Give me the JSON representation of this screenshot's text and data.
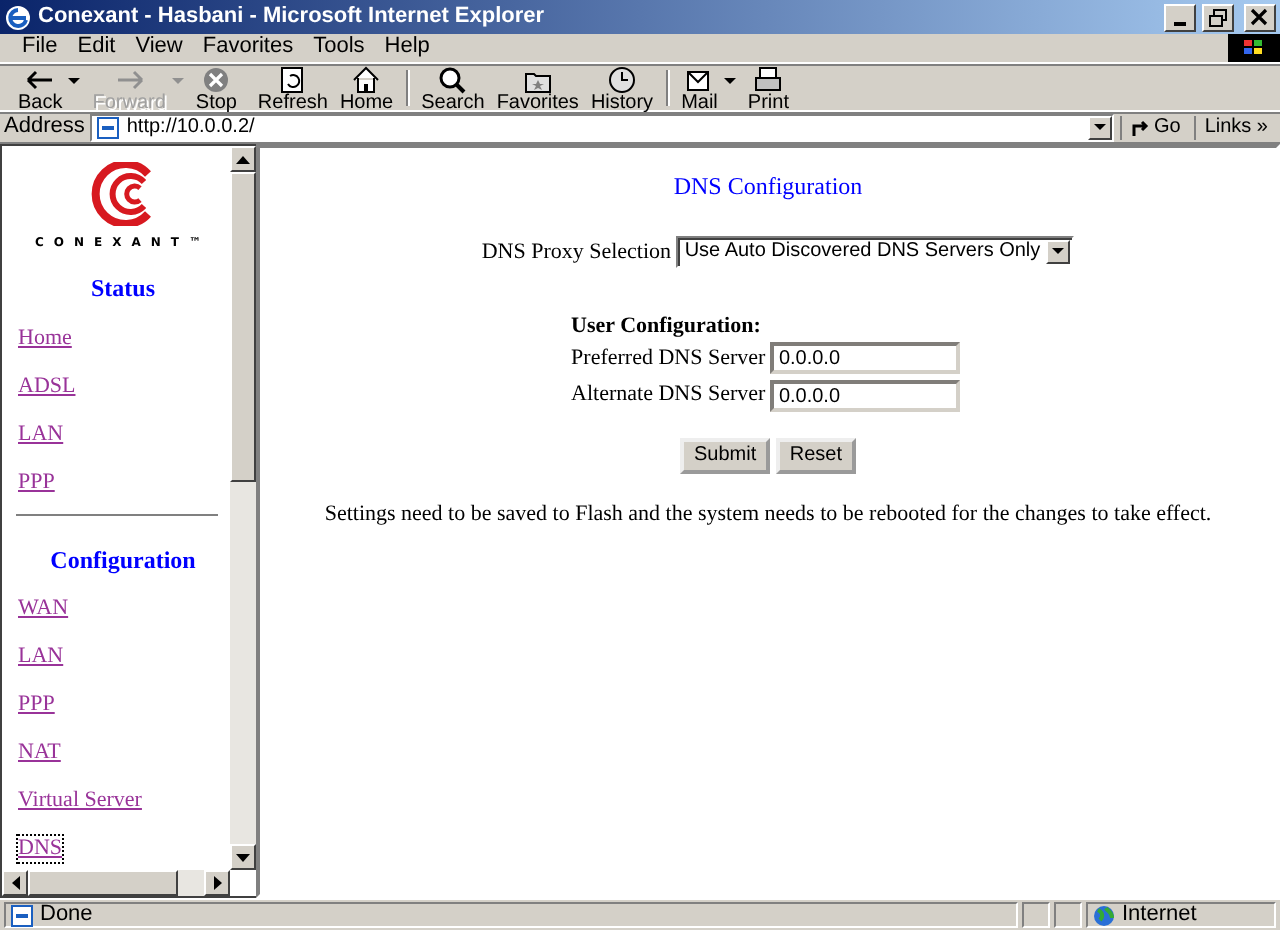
{
  "window": {
    "title": "Conexant - Hasbani - Microsoft Internet Explorer"
  },
  "menu": [
    "File",
    "Edit",
    "View",
    "Favorites",
    "Tools",
    "Help"
  ],
  "toolbar": [
    [
      {
        "label": "Back",
        "disabled": false,
        "dropdown": true
      },
      {
        "label": "Forward",
        "disabled": true,
        "dropdown": true
      },
      {
        "label": "Stop",
        "disabled": false,
        "dropdown": false
      },
      {
        "label": "Refresh",
        "disabled": false,
        "dropdown": false
      },
      {
        "label": "Home",
        "disabled": false,
        "dropdown": false
      }
    ],
    [
      {
        "label": "Search",
        "disabled": false,
        "dropdown": false
      },
      {
        "label": "Favorites",
        "disabled": false,
        "dropdown": false
      },
      {
        "label": "History",
        "disabled": false,
        "dropdown": false
      }
    ],
    [
      {
        "label": "Mail",
        "disabled": false,
        "dropdown": true
      },
      {
        "label": "Print",
        "disabled": false,
        "dropdown": false
      }
    ]
  ],
  "address_bar": {
    "label": "Address",
    "url": "http://10.0.0.2/",
    "go": "Go",
    "links": "Links",
    "links_chevron": "»"
  },
  "sidebar": {
    "logo_text": "CONEXANT™",
    "sections": [
      {
        "heading": "Status",
        "links": [
          {
            "label": "Home",
            "selected": false
          },
          {
            "label": "ADSL",
            "selected": false
          },
          {
            "label": "LAN",
            "selected": false
          },
          {
            "label": "PPP",
            "selected": false
          }
        ]
      },
      {
        "heading": "Configuration",
        "links": [
          {
            "label": "WAN",
            "selected": false
          },
          {
            "label": "LAN",
            "selected": false
          },
          {
            "label": "PPP",
            "selected": false
          },
          {
            "label": "NAT",
            "selected": false
          },
          {
            "label": "Virtual Server",
            "selected": false
          },
          {
            "label": "DNS",
            "selected": true
          }
        ]
      }
    ]
  },
  "main": {
    "title": "DNS Configuration",
    "proxy_label": "DNS Proxy Selection",
    "proxy_value": "Use Auto Discovered DNS Servers Only",
    "user_heading": "User Configuration:",
    "fields": [
      {
        "label": "Preferred DNS Server",
        "value": "0.0.0.0"
      },
      {
        "label": "Alternate DNS Server",
        "value": "0.0.0.0"
      }
    ],
    "buttons": [
      "Submit",
      "Reset"
    ],
    "note": "Settings need to be saved to Flash and the system needs to be rebooted for the changes to take effect."
  },
  "status_bar": {
    "text": "Done",
    "zone": "Internet"
  }
}
